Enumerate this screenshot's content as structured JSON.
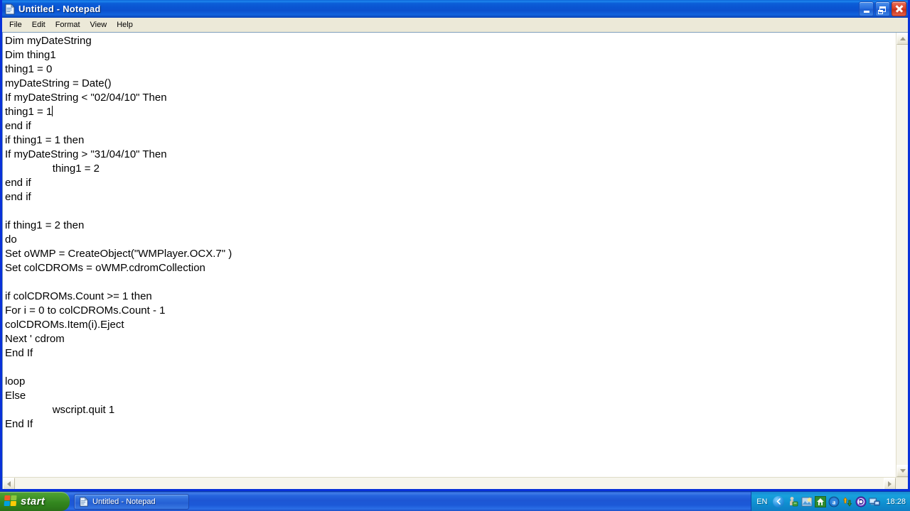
{
  "window": {
    "title": "Untitled - Notepad",
    "icon": "notepad-icon",
    "buttons": {
      "minimize": "Minimize",
      "maximize": "Maximize",
      "close": "Close"
    }
  },
  "menu": {
    "items": [
      {
        "label": "File"
      },
      {
        "label": "Edit"
      },
      {
        "label": "Format"
      },
      {
        "label": "View"
      },
      {
        "label": "Help"
      }
    ]
  },
  "editor": {
    "text": "Dim myDateString\nDim thing1\nthing1 = 0\nmyDateString = Date()\nIf myDateString < \"02/04/10\" Then\nthing1 = 1",
    "text_after_caret": "\nend if\nif thing1 = 1 then\nIf myDateString > \"31/04/10\" Then\n\t\tthing1 = 2\nend if\nend if\n\nif thing1 = 2 then\ndo\nSet oWMP = CreateObject(\"WMPlayer.OCX.7\" )\nSet colCDROMs = oWMP.cdromCollection\n\nif colCDROMs.Count >= 1 then\nFor i = 0 to colCDROMs.Count - 1\ncolCDROMs.Item(i).Eject\nNext ' cdrom\nEnd If\n\nloop\nElse\n\t\twscript.quit 1\nEnd If",
    "lines": [
      "Dim myDateString",
      "Dim thing1",
      "thing1 = 0",
      "myDateString = Date()",
      "If myDateString < \"02/04/10\" Then",
      "thing1 = 1",
      "end if",
      "if thing1 = 1 then",
      "If myDateString > \"31/04/10\" Then",
      "\t\tthing1 = 2",
      "end if",
      "end if",
      "",
      "if thing1 = 2 then",
      "do",
      "Set oWMP = CreateObject(\"WMPlayer.OCX.7\" )",
      "Set colCDROMs = oWMP.cdromCollection",
      "",
      "if colCDROMs.Count >= 1 then",
      "For i = 0 to colCDROMs.Count - 1",
      "colCDROMs.Item(i).Eject",
      "Next ' cdrom",
      "End If",
      "",
      "loop",
      "Else",
      "\t\twscript.quit 1",
      "End If"
    ],
    "caret_line": 6,
    "caret_visible": true
  },
  "scrollbars": {
    "vertical": {
      "up": "scroll-up",
      "down": "scroll-down"
    },
    "horizontal": {
      "left": "scroll-left",
      "right": "scroll-right"
    }
  },
  "taskbar": {
    "start_label": "start",
    "tasks": [
      {
        "label": "Untitled - Notepad",
        "icon": "notepad-icon",
        "active": true
      }
    ],
    "tray": {
      "language": "EN",
      "expand": "show-hidden-icons",
      "icons": [
        "network-connection-icon",
        "display-properties-icon",
        "antivirus-home-icon",
        "messenger-icon",
        "updates-icon",
        "media-icon",
        "remote-desktop-icon"
      ],
      "clock": "18:28"
    }
  },
  "colors": {
    "title_bar_blue": "#0a55d2",
    "window_border": "#0831d9",
    "menu_face": "#ece9d8",
    "text_background": "#ffffff",
    "text_color": "#000000",
    "taskbar_blue": "#1d56d4",
    "start_green": "#3c8f26",
    "close_red": "#c5321b",
    "tray_blue": "#0f8fd0"
  }
}
